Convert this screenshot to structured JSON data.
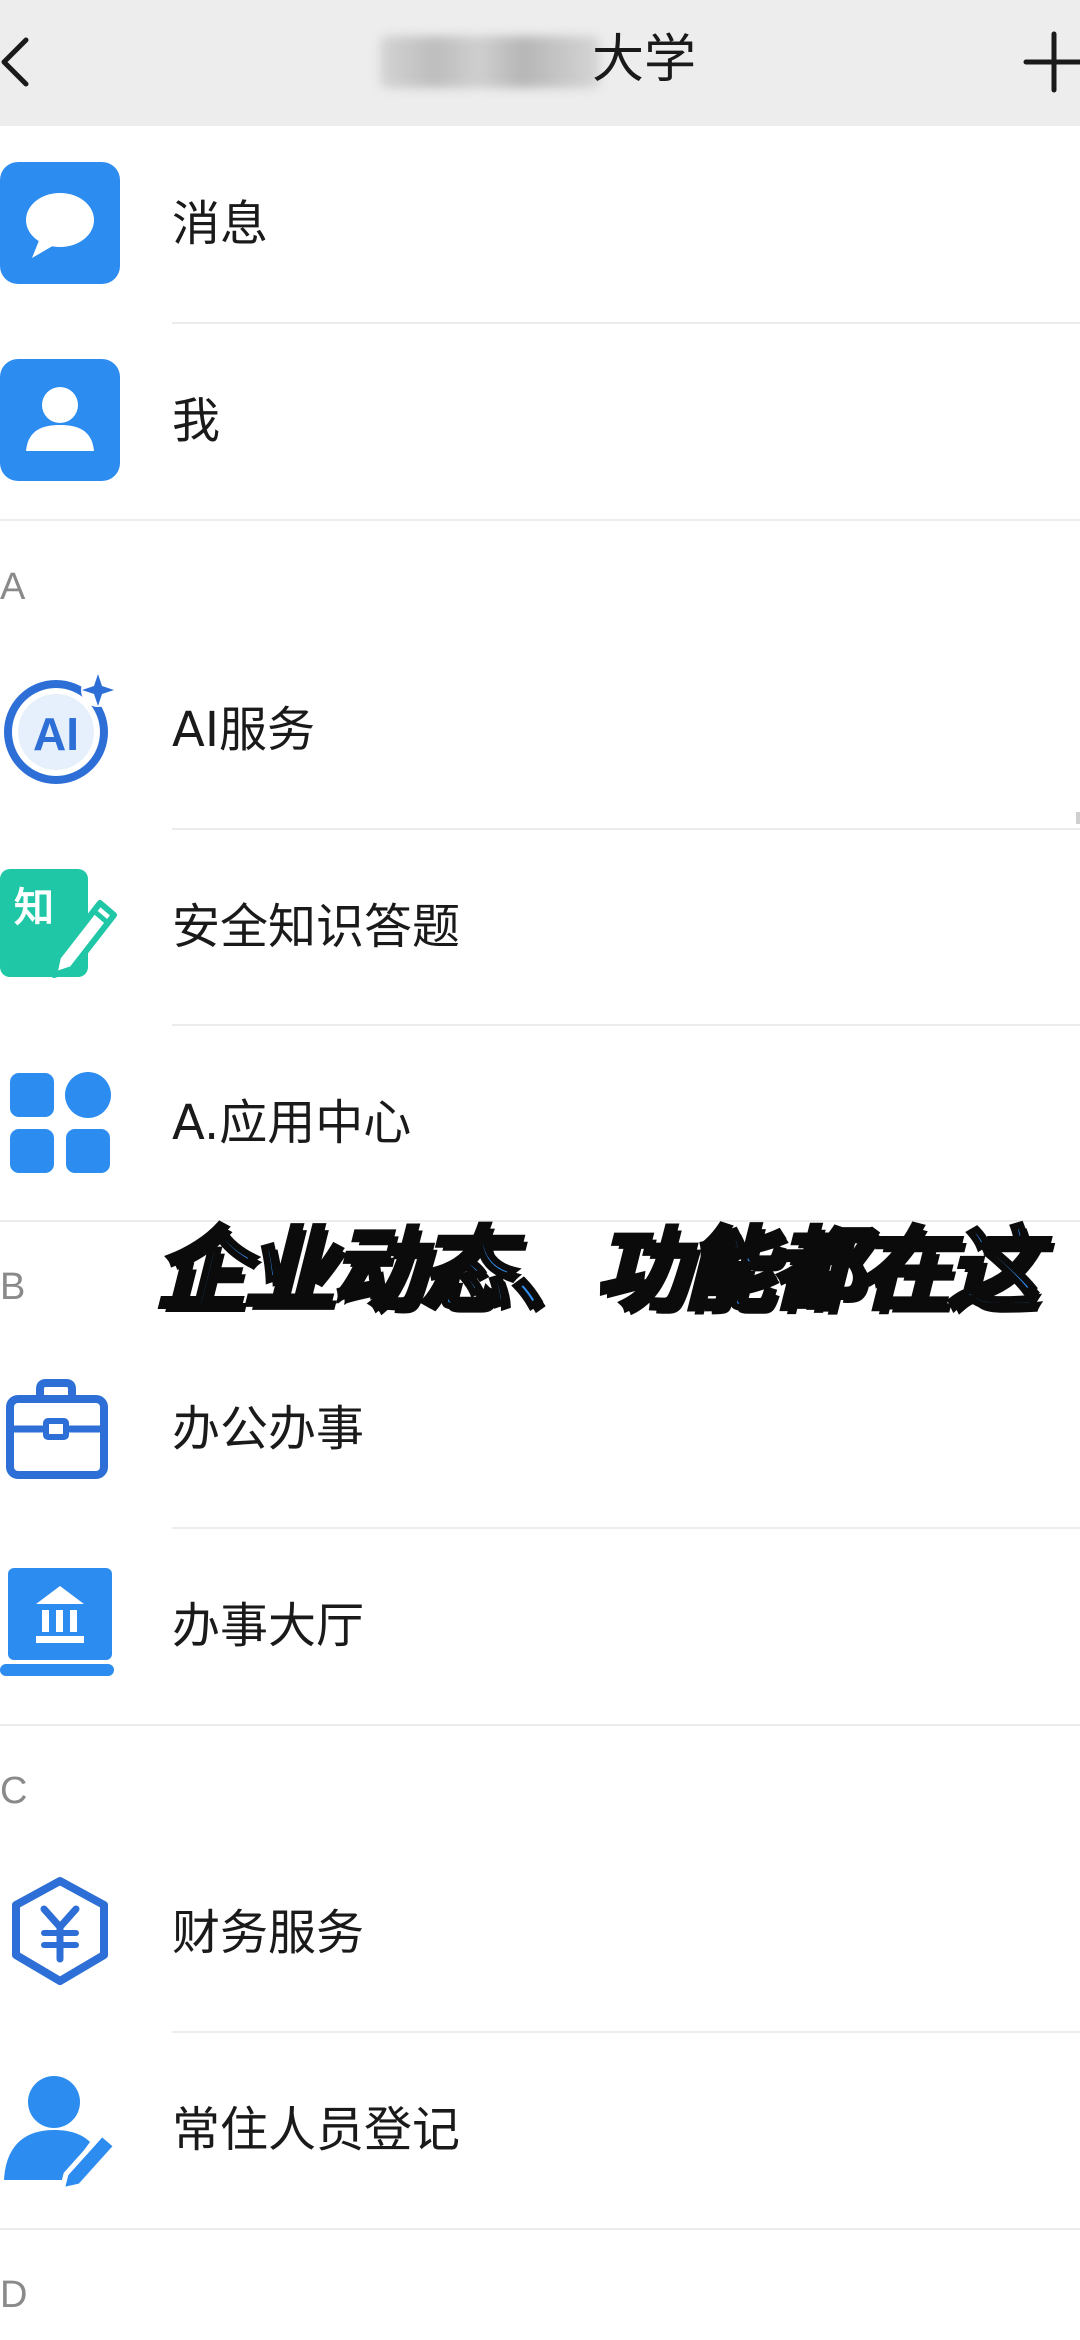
{
  "header": {
    "title_visible": "大学",
    "back_icon": "chevron-left-icon",
    "plus_icon": "plus-icon"
  },
  "list": {
    "pinned": [
      {
        "label": "消息",
        "icon": "chat-bubble-icon"
      },
      {
        "label": "我",
        "icon": "user-icon"
      }
    ],
    "sections": [
      {
        "letter": "A",
        "items": [
          {
            "label": "AI服务",
            "icon": "ai-icon"
          },
          {
            "label": "安全知识答题",
            "icon": "knowledge-quiz-icon"
          },
          {
            "label": "A.应用中心",
            "icon": "app-grid-icon"
          }
        ]
      },
      {
        "letter": "B",
        "items": [
          {
            "label": "办公办事",
            "icon": "briefcase-icon"
          },
          {
            "label": "办事大厅",
            "icon": "bank-icon"
          }
        ]
      },
      {
        "letter": "C",
        "items": [
          {
            "label": "财务服务",
            "icon": "yuan-hexagon-icon"
          },
          {
            "label": "常住人员登记",
            "icon": "user-edit-icon"
          }
        ]
      },
      {
        "letter": "D",
        "items": []
      }
    ]
  },
  "overlay": {
    "caption": "企业动态、功能都在这"
  },
  "colors": {
    "header_bg": "#ededed",
    "icon_blue": "#2d8cf0",
    "icon_teal": "#1fc7a6",
    "caption_fill": "#2f8ef0"
  }
}
